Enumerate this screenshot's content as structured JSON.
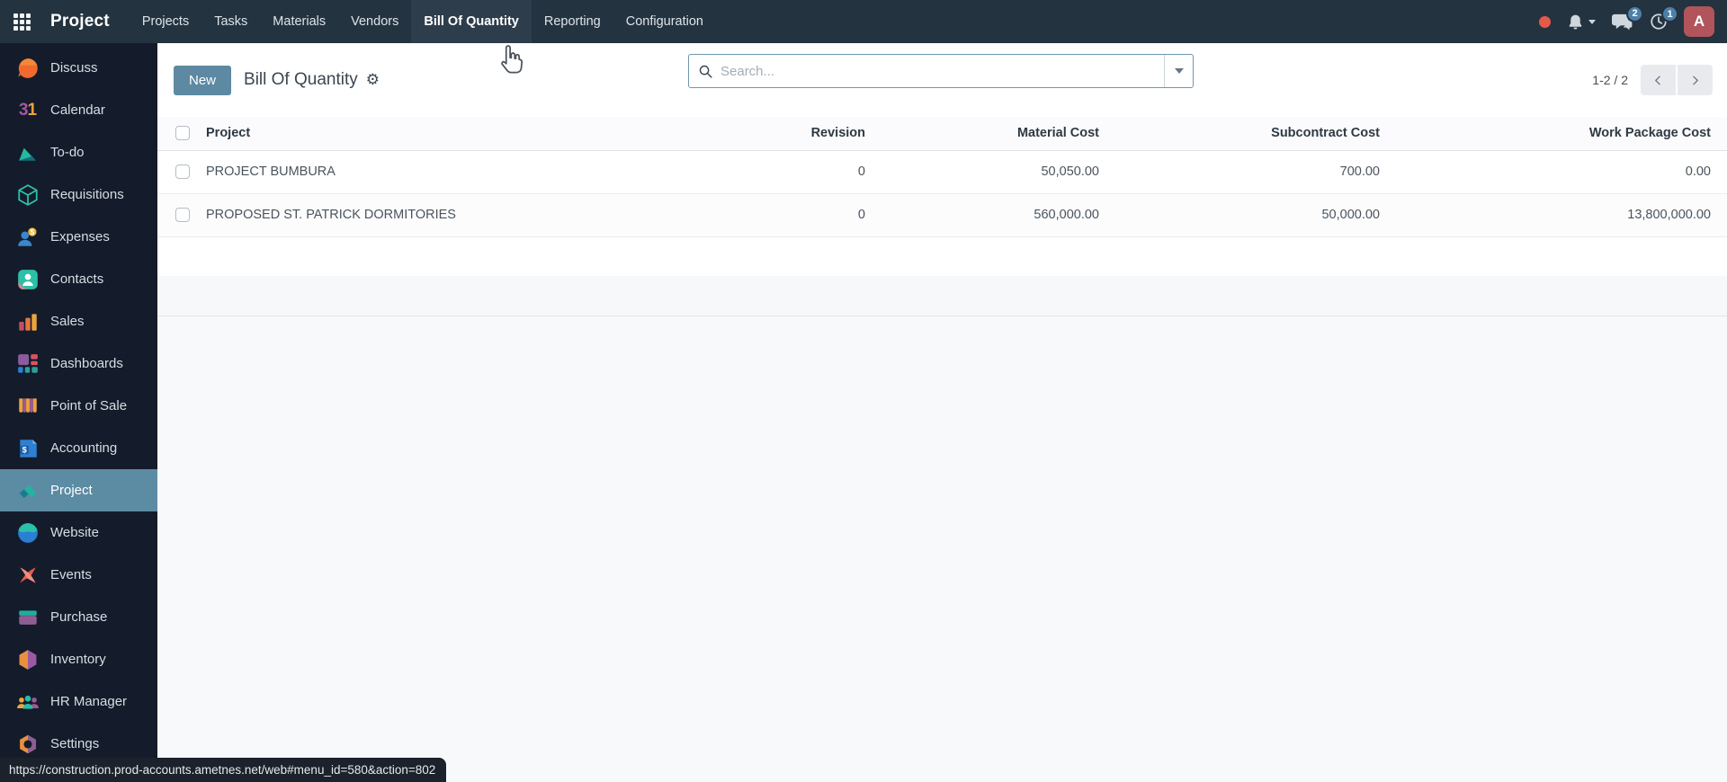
{
  "navbar": {
    "brand": "Project",
    "menu_items": [
      "Projects",
      "Tasks",
      "Materials",
      "Vendors",
      "Bill Of Quantity",
      "Reporting",
      "Configuration"
    ],
    "active_menu_item": "Bill Of Quantity",
    "badges": {
      "messages": "2",
      "activities": "1"
    },
    "avatar_initial": "A"
  },
  "sidebar": {
    "active_item": "Project",
    "items": [
      {
        "label": "Discuss",
        "icon": "discuss-icon"
      },
      {
        "label": "Calendar",
        "icon": "calendar-icon",
        "day": "31"
      },
      {
        "label": "To-do",
        "icon": "todo-icon"
      },
      {
        "label": "Requisitions",
        "icon": "requisitions-icon"
      },
      {
        "label": "Expenses",
        "icon": "expenses-icon"
      },
      {
        "label": "Contacts",
        "icon": "contacts-icon"
      },
      {
        "label": "Sales",
        "icon": "sales-icon"
      },
      {
        "label": "Dashboards",
        "icon": "dashboards-icon"
      },
      {
        "label": "Point of Sale",
        "icon": "point-of-sale-icon"
      },
      {
        "label": "Accounting",
        "icon": "accounting-icon"
      },
      {
        "label": "Project",
        "icon": "project-icon"
      },
      {
        "label": "Website",
        "icon": "website-icon"
      },
      {
        "label": "Events",
        "icon": "events-icon"
      },
      {
        "label": "Purchase",
        "icon": "purchase-icon"
      },
      {
        "label": "Inventory",
        "icon": "inventory-icon"
      },
      {
        "label": "HR Manager",
        "icon": "hr-manager-icon"
      },
      {
        "label": "Settings",
        "icon": "settings-icon"
      }
    ]
  },
  "control_panel": {
    "new_button_label": "New",
    "title": "Bill Of Quantity",
    "search_placeholder": "Search...",
    "pager_text": "1-2 / 2"
  },
  "table": {
    "columns": [
      "Project",
      "Revision",
      "Material Cost",
      "Subcontract Cost",
      "Work Package Cost"
    ],
    "rows": [
      {
        "project": "PROJECT BUMBURA",
        "revision": "0",
        "material_cost": "50,050.00",
        "subcontract_cost": "700.00",
        "work_package_cost": "0.00"
      },
      {
        "project": "PROPOSED ST. PATRICK DORMITORIES",
        "revision": "0",
        "material_cost": "560,000.00",
        "subcontract_cost": "50,000.00",
        "work_package_cost": "13,800,000.00"
      }
    ]
  },
  "statusbar": {
    "url": "https://construction.prod-accounts.ametnes.net/web#menu_id=580&action=802"
  },
  "colors": {
    "accent": "#5d89a2",
    "navbar_bg": "#243340",
    "navbar_active_bg": "#2d3d4b",
    "sidebar_bg": "#141c2b",
    "sidebar_active_bg": "#5c8ba4",
    "badge": "#4d80a8",
    "avatar_bg": "#b2545c",
    "alert_dot": "#e35a4b",
    "page_bg": "#f8f9fb"
  }
}
